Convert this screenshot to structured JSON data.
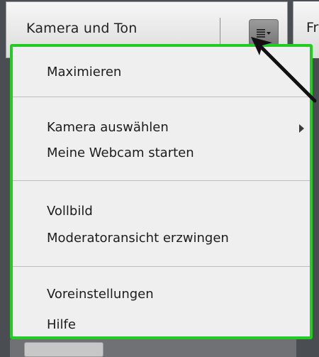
{
  "pod": {
    "title": "Kamera und Ton",
    "menu_button_icon": "menu-lines-dropdown-icon"
  },
  "next_pod": {
    "title_fragment": "Fr"
  },
  "menu": {
    "items": [
      {
        "label": "Maximieren"
      },
      {
        "label": "Kamera auswählen",
        "has_submenu": true
      },
      {
        "label": "Meine Webcam starten"
      },
      {
        "label": "Vollbild"
      },
      {
        "label": "Moderatoransicht erzwingen"
      },
      {
        "label": "Voreinstellungen"
      },
      {
        "label": "Hilfe"
      }
    ],
    "highlight_color": "#22cc22"
  },
  "annotation": {
    "arrow_color": "#111111",
    "icon": "pointer-arrow-icon"
  }
}
